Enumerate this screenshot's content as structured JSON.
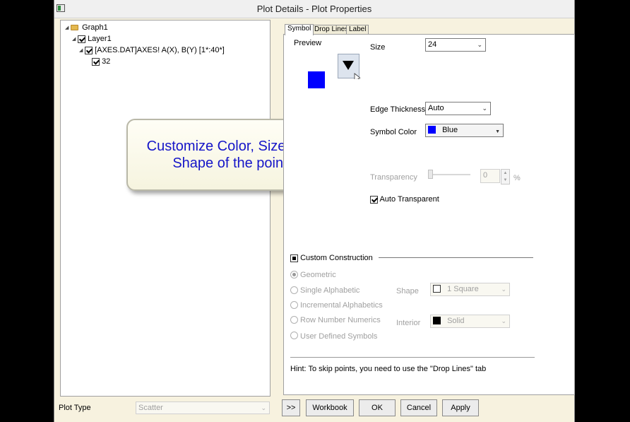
{
  "window": {
    "title": "Plot Details - Plot Properties"
  },
  "tree": {
    "root": "Graph1",
    "layer": "Layer1",
    "dataset": "[AXES.DAT]AXES! A(X), B(Y) [1*:40*]",
    "point": "32"
  },
  "callout": {
    "line1": "Customize Color, Size and",
    "line2": "Shape of the point"
  },
  "tabs": [
    "Symbol",
    "Drop Lines",
    "Label"
  ],
  "symbol": {
    "preview_label": "Preview",
    "preview_color": "#0000ff",
    "size_label": "Size",
    "size_value": "24",
    "edge_label": "Edge Thickness",
    "edge_value": "Auto",
    "color_label": "Symbol Color",
    "color_value": "Blue",
    "color_hex": "#0000ff",
    "transparency_label": "Transparency",
    "transparency_value": "0",
    "transparency_unit": "%",
    "auto_transparent_label": "Auto Transparent",
    "custom_construction_label": "Custom Construction",
    "options": [
      "Geometric",
      "Single Alphabetic",
      "Incremental Alphabetics",
      "Row Number Numerics",
      "User Defined Symbols"
    ],
    "shape_label": "Shape",
    "shape_value": "1 Square",
    "interior_label": "Interior",
    "interior_value": "Solid",
    "hint": "Hint: To skip points, you need to use the \"Drop Lines\" tab"
  },
  "footer": {
    "plot_type_label": "Plot Type",
    "plot_type_value": "Scatter",
    "more_button": ">>",
    "workbook_button": "Workbook",
    "ok_button": "OK",
    "cancel_button": "Cancel",
    "apply_button": "Apply"
  }
}
